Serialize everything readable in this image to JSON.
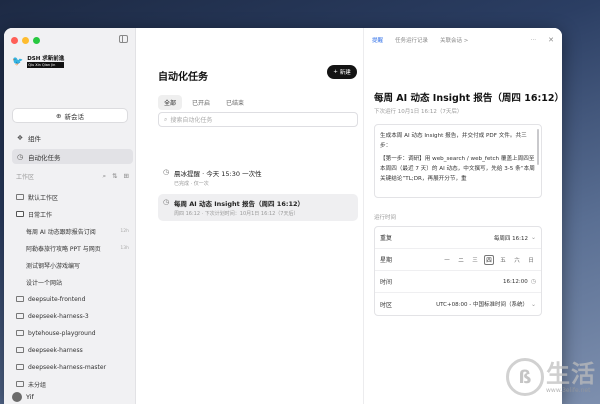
{
  "sidebar": {
    "brand": {
      "name": "DSH 求新前進",
      "sub": "Qiu Xin Qian Jin"
    },
    "new_chat": "新会话",
    "nav": [
      {
        "label": "组件",
        "icon": "component-icon"
      },
      {
        "label": "自动化任务",
        "icon": "clock-icon",
        "active": true
      }
    ],
    "workspace_header": "工作区",
    "tree": [
      {
        "label": "默认工作区",
        "type": "folder",
        "level": 0,
        "meta": ""
      },
      {
        "label": "日常工作",
        "type": "folder-open",
        "level": 0,
        "meta": ""
      },
      {
        "label": "每周 AI 动态跟踪报告订阅",
        "type": "item",
        "level": 1,
        "meta": "12h"
      },
      {
        "label": "阿勒泰旅行攻略 PPT 与网页",
        "type": "item",
        "level": 1,
        "meta": "13h"
      },
      {
        "label": "测试钢琴小游戏编写",
        "type": "item",
        "level": 1,
        "meta": ""
      },
      {
        "label": "设计一个网站",
        "type": "item",
        "level": 1,
        "meta": ""
      },
      {
        "label": "deepsuite-frontend",
        "type": "folder",
        "level": 0,
        "meta": ""
      },
      {
        "label": "deepseek-harness-3",
        "type": "folder",
        "level": 0,
        "meta": ""
      },
      {
        "label": "bytehouse-playground",
        "type": "folder",
        "level": 0,
        "meta": ""
      },
      {
        "label": "deepseek-harness",
        "type": "folder",
        "level": 0,
        "meta": ""
      },
      {
        "label": "deepseek-harness-master",
        "type": "folder",
        "level": 0,
        "meta": ""
      },
      {
        "label": "未分组",
        "type": "folder",
        "level": 0,
        "meta": ""
      }
    ],
    "user": "Yif"
  },
  "middle": {
    "title": "自动化任务",
    "new_button": "新建",
    "tabs": [
      {
        "label": "全部",
        "active": true
      },
      {
        "label": "已开启",
        "active": false
      },
      {
        "label": "已结束",
        "active": false
      }
    ],
    "search_placeholder": "搜索自动化任务",
    "tasks": [
      {
        "name": "晨冰提醒 · 今天 15:30 一次性",
        "sub": "已完成 · 仅一次",
        "meta": ""
      },
      {
        "name": "每周 AI 动态 Insight 报告（周四 16:12）",
        "sub": "周四 16:12 · 下次计划时间：10月1日 16:12（7天后）",
        "meta": ""
      }
    ]
  },
  "detail": {
    "tabs": [
      "提醒",
      "任务运行记录",
      "关联会话 >"
    ],
    "title": "每周 AI 动态 Insight 报告（周四 16:12）",
    "subtitle": "下次运行 10月1日 16:12（7天后）",
    "prompt_p1": "生成本周 AI 动态 Insight 报告，并交付成 PDF 文件。共三步：",
    "prompt_p2": "【第一步：调研】用 web_search / web_fetch 覆盖上周四至本周四（最近 7 天）的 AI 动态，中文撰写，先给 3-5 条“本周关键结论”TL;DR，再展开分节，重",
    "schedule_label": "运行时间",
    "repeat_label": "重复",
    "repeat_value": "每周四 16:12",
    "weekday_label": "星期",
    "weekdays": [
      "一",
      "二",
      "三",
      "四",
      "五",
      "六",
      "日"
    ],
    "selected_weekday": "四",
    "time_label": "时间",
    "time_value": "16:12:00",
    "tz_label": "时区",
    "tz_value": "UTC+08:00 - 中国标准时间（系统）"
  },
  "watermark": {
    "char": "生活",
    "url": "www.3elife.net"
  }
}
